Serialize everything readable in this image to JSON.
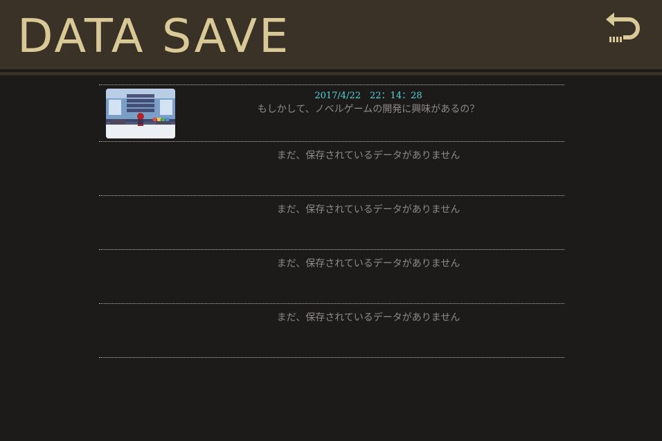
{
  "header": {
    "title": "DATA SAVE",
    "back_icon": "return-arrow-icon"
  },
  "colors": {
    "header_bg": "#3a3226",
    "title": "#d8c996",
    "background": "#1c1b19",
    "timestamp": "#4fd6d9",
    "slot_text": "#8e8b85"
  },
  "slots": [
    {
      "timestamp": "2017/4/22　22：14：28",
      "text": "もしかして、ノベルゲームの開発に興味があるの？",
      "has_thumbnail": true
    },
    {
      "text": "まだ、保存されているデータがありません"
    },
    {
      "text": "まだ、保存されているデータがありません"
    },
    {
      "text": "まだ、保存されているデータがありません"
    },
    {
      "text": "まだ、保存されているデータがありません"
    }
  ]
}
